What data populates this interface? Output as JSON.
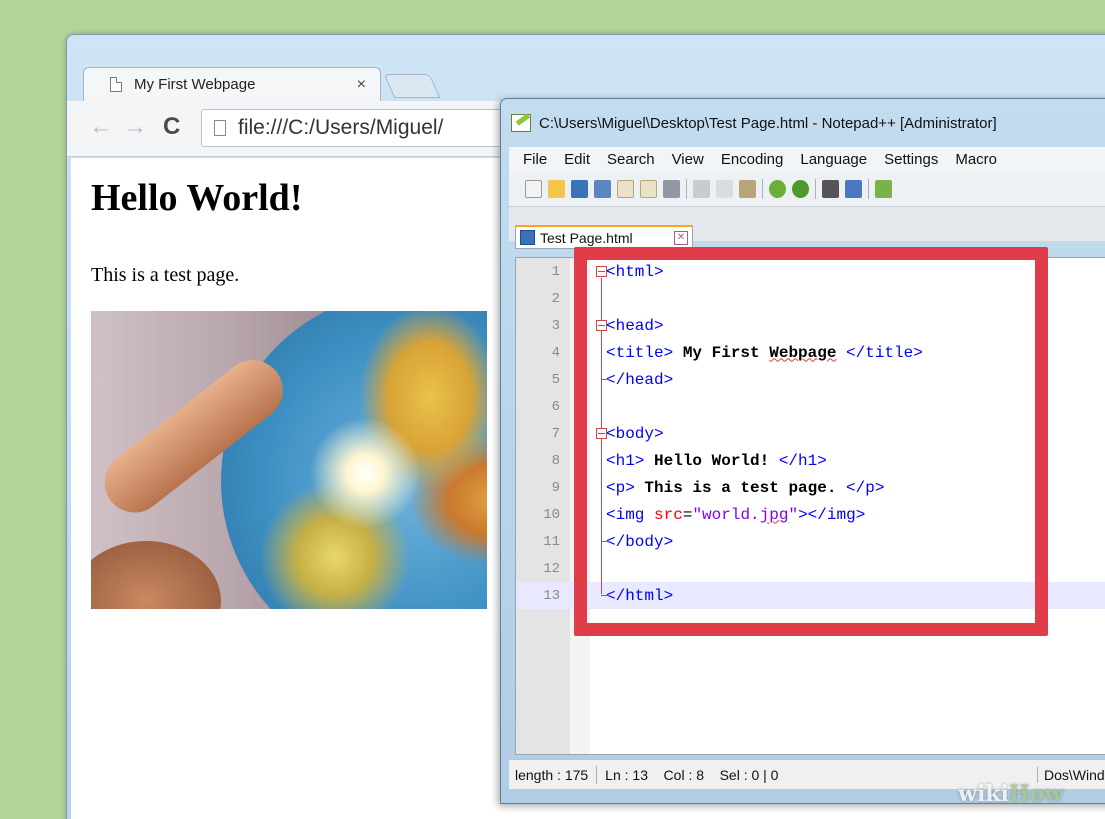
{
  "browser": {
    "tab_title": "My First Webpage",
    "tab_close": "×",
    "nav": {
      "back": "←",
      "forward": "→",
      "reload": "C"
    },
    "url": "file:///C:/Users/Miguel/",
    "page": {
      "heading": "Hello World!",
      "paragraph": "This is a test page."
    }
  },
  "notepad": {
    "title": "C:\\Users\\Miguel\\Desktop\\Test Page.html - Notepad++ [Administrator]",
    "menu": [
      "File",
      "Edit",
      "Search",
      "View",
      "Encoding",
      "Language",
      "Settings",
      "Macro"
    ],
    "doc_tab": "Test Page.html",
    "lines": [
      {
        "n": "1"
      },
      {
        "n": "2"
      },
      {
        "n": "3"
      },
      {
        "n": "4"
      },
      {
        "n": "5"
      },
      {
        "n": "6"
      },
      {
        "n": "7"
      },
      {
        "n": "8"
      },
      {
        "n": "9"
      },
      {
        "n": "10"
      },
      {
        "n": "11"
      },
      {
        "n": "12"
      },
      {
        "n": "13"
      }
    ],
    "code": {
      "l1": "<html>",
      "l3": "<head>",
      "l4_open": "<title>",
      "l4_text": " My First ",
      "l4_word": "Webpage",
      "l4_close": " </title>",
      "l5": "</head>",
      "l7": "<body>",
      "l8_open": "<h1>",
      "l8_text": " Hello World! ",
      "l8_close": "</h1>",
      "l9_open": "<p>",
      "l9_text": " This is a test page. ",
      "l9_close": "</p>",
      "l10_open": "<img ",
      "l10_attr": "src",
      "l10_eq": "=",
      "l10_val1": "\"world.",
      "l10_val2": "jpg",
      "l10_val3": "\"",
      "l10_close": "></img>",
      "l11": "</body>",
      "l13": "</html>"
    },
    "status": {
      "length": "length : 175",
      "position": "Ln : 13    Col : 8    Sel : 0 | 0",
      "eol": "Dos\\Windows"
    }
  },
  "watermark": {
    "wiki": "wiki",
    "how": "How"
  },
  "colors": {
    "highlight": "#e13c4a",
    "tag": "#0000ff",
    "attr": "#ff0000",
    "value": "#8000ff"
  }
}
